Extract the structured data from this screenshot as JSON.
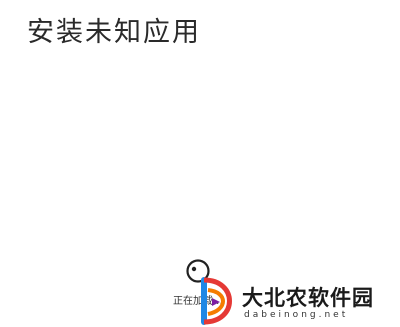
{
  "page": {
    "title": "安装未知应用",
    "loading_text": "正在加载...",
    "spinner_icon": "loading-spinner-icon"
  },
  "watermark": {
    "name": "大北农软件园",
    "domain": "dabeinong.net",
    "logo_icon": "dabeinong-logo-icon",
    "colors": {
      "blue": "#1e88e5",
      "orange": "#f57c00",
      "red": "#e53935",
      "purple": "#7b1fa2"
    }
  }
}
